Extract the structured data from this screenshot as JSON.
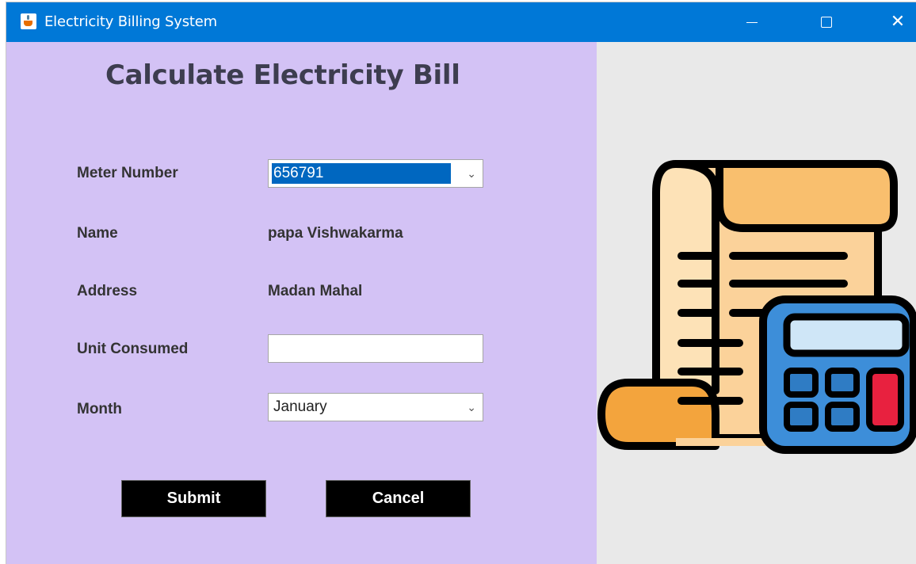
{
  "window": {
    "title": "Electricity Billing System"
  },
  "form": {
    "heading": "Calculate Electricity Bill",
    "meter_number_label": "Meter Number",
    "meter_number_value": "656791",
    "name_label": "Name",
    "name_value": "papa Vishwakarma",
    "address_label": "Address",
    "address_value": "Madan Mahal",
    "unit_consumed_label": "Unit Consumed",
    "unit_consumed_value": "",
    "month_label": "Month",
    "month_value": "January",
    "submit_label": "Submit",
    "cancel_label": "Cancel"
  },
  "colors": {
    "titlebar": "#0078d7",
    "panel_bg": "#d3c2f5",
    "button_bg": "#000000"
  },
  "icons": {
    "app": "java-cup-icon",
    "illustration": "bill-calculator-icon"
  }
}
